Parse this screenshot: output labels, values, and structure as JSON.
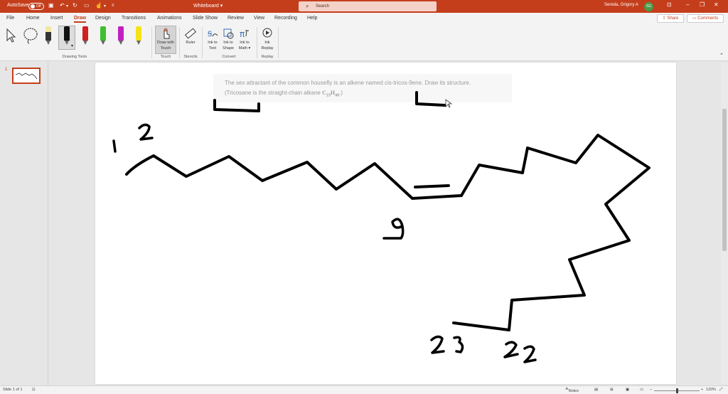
{
  "titlebar": {
    "autosave_label": "AutoSave",
    "autosave_state": "Off",
    "doc_title": "Whiteboard",
    "search_placeholder": "Search",
    "user_name": "Sereda, Grigory A",
    "user_initials": "SG"
  },
  "tabs": [
    "File",
    "Home",
    "Insert",
    "Draw",
    "Design",
    "Transitions",
    "Animations",
    "Slide Show",
    "Review",
    "View",
    "Recording",
    "Help"
  ],
  "active_tab": "Draw",
  "share_label": "Share",
  "comments_label": "Comments",
  "ribbon": {
    "groups": {
      "drawing_tools": "Drawing Tools",
      "touch": "Touch",
      "stencils": "Stencils",
      "convert": "Convert",
      "replay": "Replay"
    },
    "draw_with_touch": "Draw with Touch",
    "ruler": "Ruler",
    "ink_to_text": "Ink to Text",
    "ink_to_shape": "Ink to Shape",
    "ink_to_math": "Ink to Math",
    "ink_replay": "Ink Replay",
    "pen_colors": [
      "#f2e6a0",
      "#111111",
      "#d21f1f",
      "#3fbf2f",
      "#c020c0",
      "#f5e31a"
    ]
  },
  "slides_pane": {
    "slide_number": "1"
  },
  "slide": {
    "prompt_line1": "The sex attractant of the common housefly is an alkene named cis-tricos-9ene. Draw its structure.",
    "prompt_line2_prefix": "(Tricosane is the straight-chain alkane ",
    "formula": "C23H48",
    "prompt_line2_suffix": ".)",
    "ink_labels": [
      "1",
      "2",
      "9",
      "23",
      "22"
    ]
  },
  "statusbar": {
    "slide_info": "Slide 1 of 1",
    "notes": "Notes",
    "zoom": "120%"
  }
}
